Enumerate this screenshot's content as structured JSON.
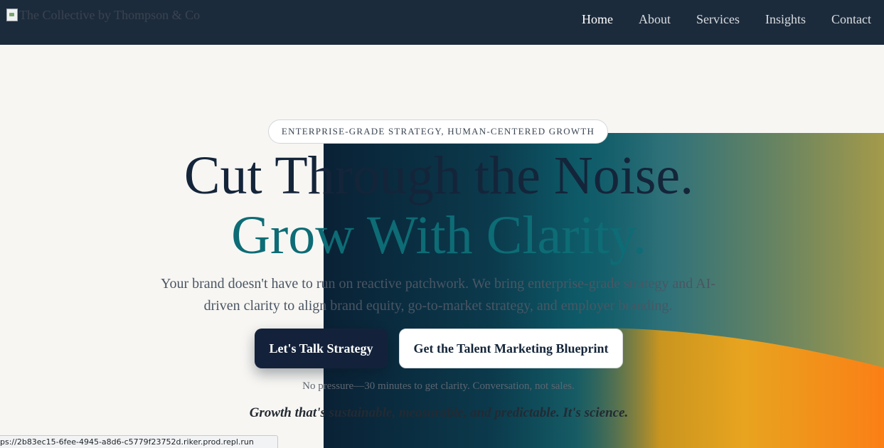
{
  "header": {
    "logo_alt": "The Collective by Thompson & Co",
    "nav": [
      {
        "label": "Home",
        "active": true
      },
      {
        "label": "About",
        "active": false
      },
      {
        "label": "Services",
        "active": false
      },
      {
        "label": "Insights",
        "active": false
      },
      {
        "label": "Contact",
        "active": false
      }
    ]
  },
  "hero": {
    "badge": "ENTERPRISE-GRADE STRATEGY, HUMAN-CENTERED GROWTH",
    "headline_line1": "Cut Through the Noise.",
    "headline_line2": "Grow With Clarity.",
    "subtext": "Your brand doesn't have to run on reactive patchwork. We bring enterprise-grade strategy and AI-driven clarity to align brand equity, go-to-market strategy, and employer branding.",
    "primary_button": "Let's Talk Strategy",
    "secondary_button": "Get the Talent Marketing Blueprint",
    "note": "No pressure—30 minutes to get clarity. Conversation, not sales.",
    "tagline": "Growth that's sustainable, measurable, and predictable. It's science."
  },
  "status_bar": {
    "url": "ps://2b83ec15-6fee-4945-a8d6-c5779f23752d.riker.prod.repl.run"
  },
  "colors": {
    "nav_bg": "#1c2b3b",
    "page_bg": "#f7f6f3",
    "headline_dark": "#14253a",
    "headline_teal": "#0d6c75",
    "accent_orange": "#f7831d"
  }
}
